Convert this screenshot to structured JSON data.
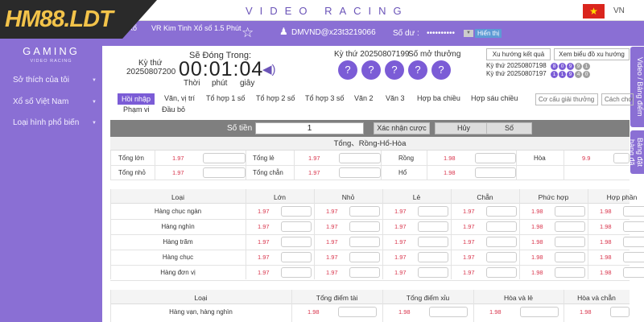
{
  "brand": {
    "logo": "HM88.LDT",
    "gaming": "GAMING",
    "gaming_sub": "VIDEO RACING"
  },
  "sidebar": {
    "items": [
      {
        "label": "Sở thích của tôi"
      },
      {
        "label": "Xổ số Việt Nam"
      },
      {
        "label": "Loại hình phổ biến"
      }
    ]
  },
  "header": {
    "title": "VIDEO RACING",
    "lang": "VN"
  },
  "game": {
    "short": "Xổ",
    "name": "VR Kim Tinh Xổ số 1.5 Phút",
    "user": "DMVND@x23t3219066",
    "balance_label": "Số dư :",
    "balance": "••••••••••",
    "show_label": "Hiển thị"
  },
  "current": {
    "draw_label": "Kỳ thứ",
    "draw_number": "20250807200",
    "close_label": "Sẽ Đóng Trong:",
    "timer": "00:01:04",
    "units": [
      "Thời",
      "phút",
      "giây"
    ]
  },
  "result": {
    "label": "Kỳ thứ 20250807199",
    "label2": "Số mở thưởng",
    "balls": [
      "?",
      "?",
      "?",
      "?",
      "?"
    ]
  },
  "trend": {
    "buttons": [
      "Xu hướng kết quả",
      "Xem biểu đồ xu hướng"
    ],
    "history": [
      {
        "label": "Kỳ thứ 20250807198",
        "balls": [
          "8",
          "0",
          "9",
          "9",
          "1"
        ]
      },
      {
        "label": "Kỳ thứ 20250807197",
        "balls": [
          "1",
          "1",
          "9",
          "4",
          "0"
        ]
      }
    ]
  },
  "side_tabs": [
    "Video / Bảng điểm",
    "Bảng đặt hàng đã"
  ],
  "filters": {
    "active": "Hồi nhập",
    "items": [
      "Văn, vị trí",
      "Tổ hợp 1 số",
      "Tổ hợp 2 số",
      "Tổ hợp 3 số",
      "Văn 2",
      "Văn 3",
      "Hợp ba chiều",
      "Hợp sáu chiều",
      "Phạm vi",
      "Đầu bỏ"
    ],
    "search_placeholder": "Cơ cấu giải thưởng",
    "search2": "Cách chơi"
  },
  "amount": {
    "label": "Số tiền",
    "value": "1",
    "confirm": "Xác nhận cược",
    "cancel": "Hủy",
    "clear": "Số"
  },
  "section1": {
    "title": "Tổng、Rồng-Hổ-Hòa",
    "rows": [
      [
        {
          "label": "Tổng lớn",
          "odds": "1.97"
        },
        {
          "label": "Tổng lẻ",
          "odds": "1.97"
        },
        {
          "label": "Rồng",
          "odds": "1.98"
        },
        {
          "label": "Hòa",
          "odds": "9.9"
        }
      ],
      [
        {
          "label": "Tổng nhỏ",
          "odds": "1.97"
        },
        {
          "label": "Tổng chẵn",
          "odds": "1.97"
        },
        {
          "label": "Hổ",
          "odds": "1.98"
        }
      ]
    ]
  },
  "section2": {
    "headers": [
      "Loại",
      "Lớn",
      "Nhỏ",
      "Lẻ",
      "Chẵn",
      "Phức hợp",
      "Hợp phần"
    ],
    "rows": [
      {
        "label": "Hàng chục ngàn",
        "odds": [
          "1.97",
          "1.97",
          "1.97",
          "1.97",
          "1.98",
          "1.98"
        ]
      },
      {
        "label": "Hàng nghìn",
        "odds": [
          "1.97",
          "1.97",
          "1.97",
          "1.97",
          "1.98",
          "1.98"
        ]
      },
      {
        "label": "Hàng trăm",
        "odds": [
          "1.97",
          "1.97",
          "1.97",
          "1.97",
          "1.98",
          "1.98"
        ]
      },
      {
        "label": "Hàng chục",
        "odds": [
          "1.97",
          "1.97",
          "1.97",
          "1.97",
          "1.98",
          "1.98"
        ]
      },
      {
        "label": "Hàng đơn vị",
        "odds": [
          "1.97",
          "1.97",
          "1.97",
          "1.97",
          "1.98",
          "1.98"
        ]
      }
    ]
  },
  "section3": {
    "headers": [
      "Loại",
      "Tổng điểm tài",
      "Tổng điểm xỉu",
      "Hòa và lẻ",
      "Hòa và chẵn"
    ],
    "rows": [
      {
        "label": "Hàng vạn, hàng nghìn",
        "odds": [
          "1.98",
          "1.98",
          "1.98",
          "1.98"
        ]
      }
    ]
  },
  "colors": {
    "purple": "#8a6fd4",
    "accent": "#7b5cd6",
    "odds": "#d9344c",
    "gold": "#f3c34a"
  }
}
